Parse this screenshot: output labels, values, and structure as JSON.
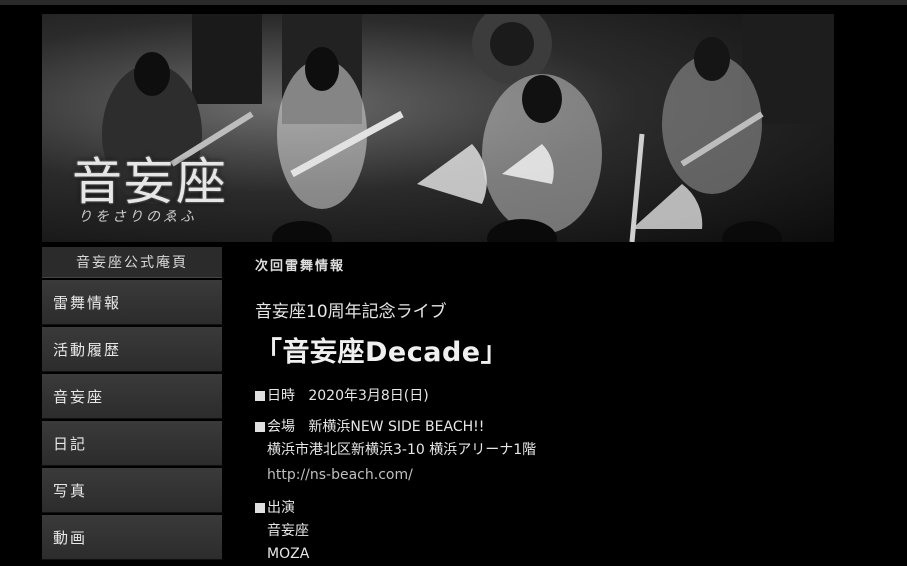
{
  "banner": {
    "logo_text": "音妄座",
    "logo_sub": "りをさりのゑふ"
  },
  "sidebar": {
    "title": "音妄座公式庵頁",
    "items": [
      {
        "label": "雷舞情報"
      },
      {
        "label": "活動履歴"
      },
      {
        "label": "音妄座"
      },
      {
        "label": "日記"
      },
      {
        "label": "写真"
      },
      {
        "label": "動画"
      }
    ]
  },
  "main": {
    "section_title": "次回雷舞情報",
    "event_subtitle": "音妄座10周年記念ライブ",
    "event_title": "「音妄座Decade」",
    "date_label": "日時",
    "date_value": "2020年3月8日(日)",
    "venue_label": "会場",
    "venue_name": "新横浜NEW SIDE BEACH!!",
    "venue_address": "横浜市港北区新横浜3-10 横浜アリーナ1階",
    "venue_url": "http://ns-beach.com/",
    "performers_label": "出演",
    "performers": [
      "音妄座",
      "MOZA"
    ]
  }
}
